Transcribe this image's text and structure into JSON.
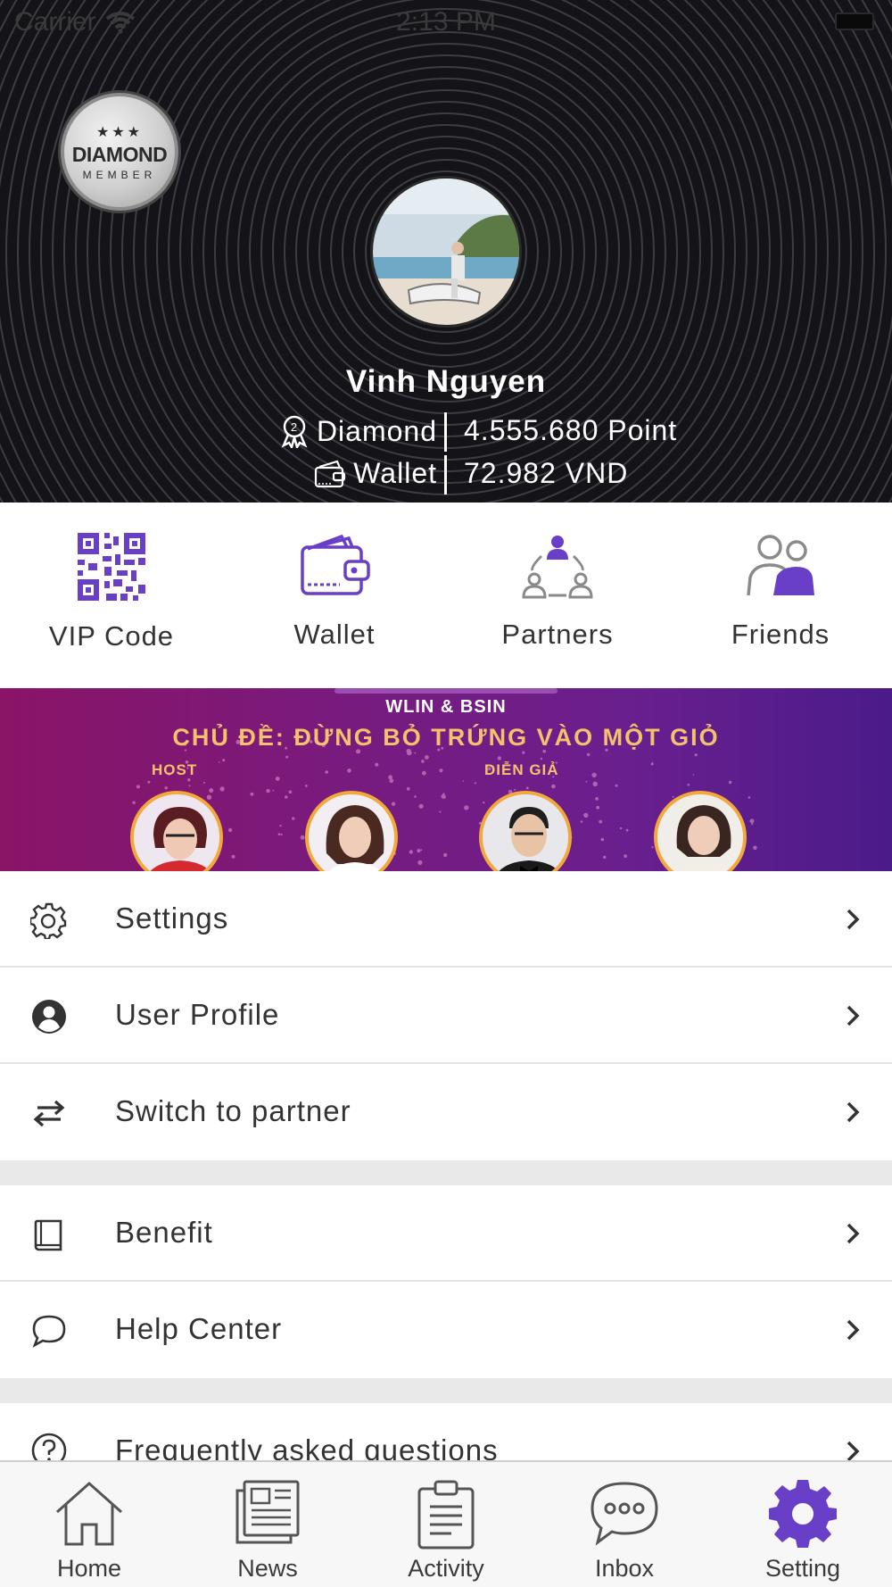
{
  "status_bar": {
    "carrier": "Carrier",
    "time": "2:13 PM"
  },
  "profile": {
    "badge": {
      "title": "DIAMOND",
      "subtitle": "MEMBER"
    },
    "name": "Vinh Nguyen",
    "tier": "Diamond",
    "points": "4.555.680 Point",
    "wallet_label": "Wallet",
    "wallet_amount": "72.982 VND"
  },
  "quick_actions": [
    {
      "label": "VIP Code",
      "icon": "qr-code-icon"
    },
    {
      "label": "Wallet",
      "icon": "wallet-icon"
    },
    {
      "label": "Partners",
      "icon": "partners-icon"
    },
    {
      "label": "Friends",
      "icon": "friends-icon"
    }
  ],
  "banner": {
    "supertitle": "WLIN & BSIN",
    "title": "CHỦ ĐỀ: ĐỪNG BỎ TRỨNG VÀO MỘT GIỎ",
    "host_label": "HOST",
    "speaker_label": "DIỄN GIẢ"
  },
  "menu": {
    "settings": "Settings",
    "user_profile": "User Profile",
    "switch_partner": "Switch to partner",
    "benefit": "Benefit",
    "help_center": "Help Center",
    "faq": "Frequently asked questions"
  },
  "tabs": [
    {
      "label": "Home",
      "icon": "home-icon"
    },
    {
      "label": "News",
      "icon": "news-icon"
    },
    {
      "label": "Activity",
      "icon": "activity-icon"
    },
    {
      "label": "Inbox",
      "icon": "inbox-icon"
    },
    {
      "label": "Setting",
      "icon": "gear-icon",
      "active": true
    }
  ],
  "colors": {
    "accent": "#6a3fc8",
    "header_bg": "#141418",
    "banner_gold": "#f4c26b",
    "separator": "#e9e9e9"
  }
}
